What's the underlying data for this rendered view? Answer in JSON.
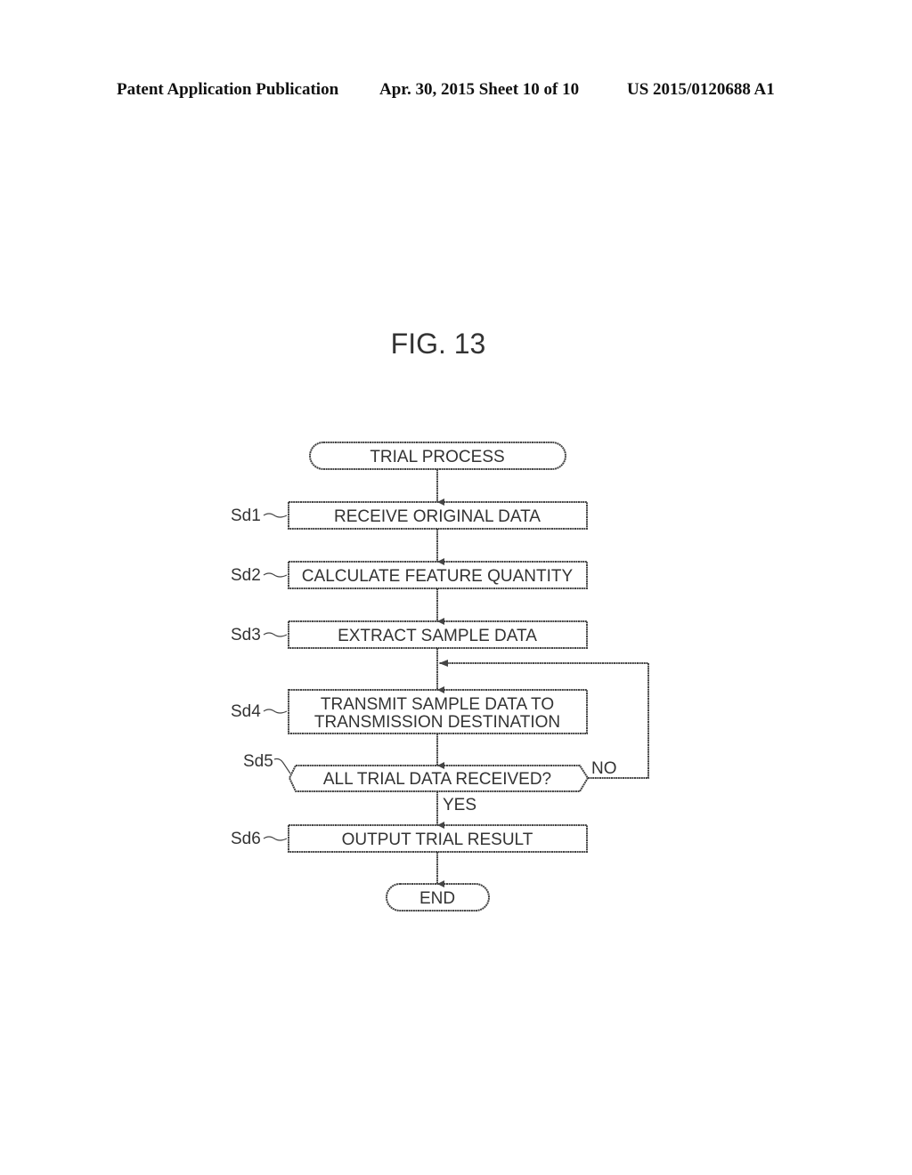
{
  "header": {
    "publication": "Patent Application Publication",
    "date_sheet": "Apr. 30, 2015  Sheet 10 of 10",
    "patent_number": "US 2015/0120688 A1"
  },
  "figure": {
    "title": "FIG. 13",
    "start": "TRIAL PROCESS",
    "end": "END",
    "steps": [
      {
        "id": "Sd1",
        "lines": [
          "RECEIVE ORIGINAL DATA"
        ]
      },
      {
        "id": "Sd2",
        "lines": [
          "CALCULATE FEATURE QUANTITY"
        ]
      },
      {
        "id": "Sd3",
        "lines": [
          "EXTRACT SAMPLE DATA"
        ]
      },
      {
        "id": "Sd4",
        "lines": [
          "TRANSMIT SAMPLE DATA TO",
          "TRANSMISSION DESTINATION"
        ]
      },
      {
        "id": "Sd5",
        "lines": [
          "ALL TRIAL DATA RECEIVED?"
        ],
        "type": "decision",
        "yes": "YES",
        "no": "NO"
      },
      {
        "id": "Sd6",
        "lines": [
          "OUTPUT TRIAL RESULT"
        ]
      }
    ]
  }
}
